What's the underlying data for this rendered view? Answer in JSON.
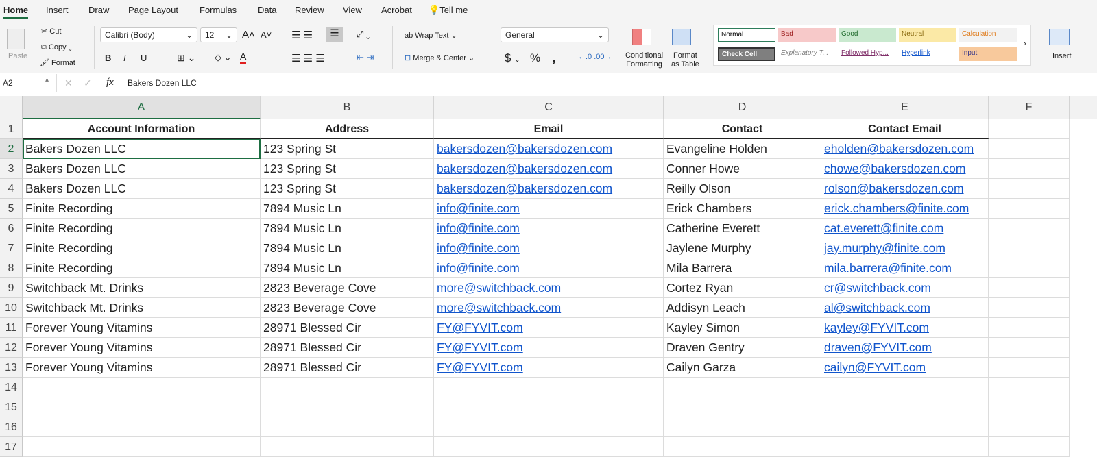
{
  "tabs": [
    "Home",
    "Insert",
    "Draw",
    "Page Layout",
    "Formulas",
    "Data",
    "Review",
    "View",
    "Acrobat",
    "Tell me"
  ],
  "ribbon": {
    "paste": "Paste",
    "cut": "Cut",
    "copy": "Copy",
    "format": "Format",
    "font": "Calibri (Body)",
    "size": "12",
    "bold": "B",
    "italic": "I",
    "underline": "U",
    "wrap": "Wrap Text",
    "merge": "Merge & Center",
    "numfmt": "General",
    "dollar": "$",
    "percent": "%",
    "comma": ",",
    "cond1": "Conditional",
    "cond2": "Formatting",
    "fat1": "Format",
    "fat2": "as Table",
    "insert": "Insert",
    "styles": [
      {
        "label": "Normal",
        "bg": "#ffffff",
        "fg": "#000000"
      },
      {
        "label": "Bad",
        "bg": "#f7c9c9",
        "fg": "#9c1c1c"
      },
      {
        "label": "Good",
        "bg": "#c9e9cf",
        "fg": "#1e6a2c"
      },
      {
        "label": "Neutral",
        "bg": "#fbe9a6",
        "fg": "#8a6a10"
      },
      {
        "label": "Calculation",
        "bg": "#f2f2f2",
        "fg": "#e07b1a"
      },
      {
        "label": "Check Cell",
        "bg": "#7f7f7f",
        "fg": "#ffffff"
      },
      {
        "label": "Explanatory T...",
        "bg": "#ffffff",
        "fg": "#777777"
      },
      {
        "label": "Followed Hyp...",
        "bg": "#ffffff",
        "fg": "#80306a"
      },
      {
        "label": "Hyperlink",
        "bg": "#ffffff",
        "fg": "#1155cc"
      },
      {
        "label": "Input",
        "bg": "#f8c99c",
        "fg": "#3a3a8a"
      }
    ]
  },
  "formula": {
    "cellref": "A2",
    "fx": "fx",
    "value": "Bakers Dozen LLC"
  },
  "columns": [
    "A",
    "B",
    "C",
    "D",
    "E",
    "F"
  ],
  "headers": [
    "Account Information",
    "Address",
    "Email",
    "Contact",
    "Contact Email"
  ],
  "rows": [
    [
      "Bakers Dozen LLC",
      "123 Spring St",
      "bakersdozen@bakersdozen.com",
      "Evangeline Holden",
      "eholden@bakersdozen.com"
    ],
    [
      "Bakers Dozen LLC",
      "123 Spring St",
      "bakersdozen@bakersdozen.com",
      "Conner Howe",
      "chowe@bakersdozen.com"
    ],
    [
      "Bakers Dozen LLC",
      "123 Spring St",
      "bakersdozen@bakersdozen.com",
      "Reilly Olson",
      "rolson@bakersdozen.com"
    ],
    [
      "Finite Recording",
      "7894 Music Ln",
      "info@finite.com",
      "Erick Chambers",
      "erick.chambers@finite.com"
    ],
    [
      "Finite Recording",
      "7894 Music Ln",
      "info@finite.com",
      "Catherine Everett",
      "cat.everett@finite.com"
    ],
    [
      "Finite Recording",
      "7894 Music Ln",
      "info@finite.com",
      "Jaylene Murphy",
      "jay.murphy@finite.com"
    ],
    [
      "Finite Recording",
      "7894 Music Ln",
      "info@finite.com",
      "Mila Barrera",
      "mila.barrera@finite.com"
    ],
    [
      "Switchback Mt. Drinks",
      "2823 Beverage Cove",
      "more@switchback.com",
      "Cortez Ryan",
      "cr@switchback.com"
    ],
    [
      "Switchback Mt. Drinks",
      "2823 Beverage Cove",
      "more@switchback.com",
      "Addisyn Leach",
      "al@switchback.com"
    ],
    [
      "Forever Young Vitamins",
      "28971 Blessed Cir",
      "FY@FYVIT.com",
      "Kayley Simon",
      "kayley@FYVIT.com"
    ],
    [
      "Forever Young Vitamins",
      "28971 Blessed Cir",
      "FY@FYVIT.com",
      "Draven Gentry",
      "draven@FYVIT.com"
    ],
    [
      "Forever Young Vitamins",
      "28971 Blessed Cir",
      "FY@FYVIT.com",
      "Cailyn Garza",
      "cailyn@FYVIT.com"
    ]
  ],
  "row_count": 17
}
